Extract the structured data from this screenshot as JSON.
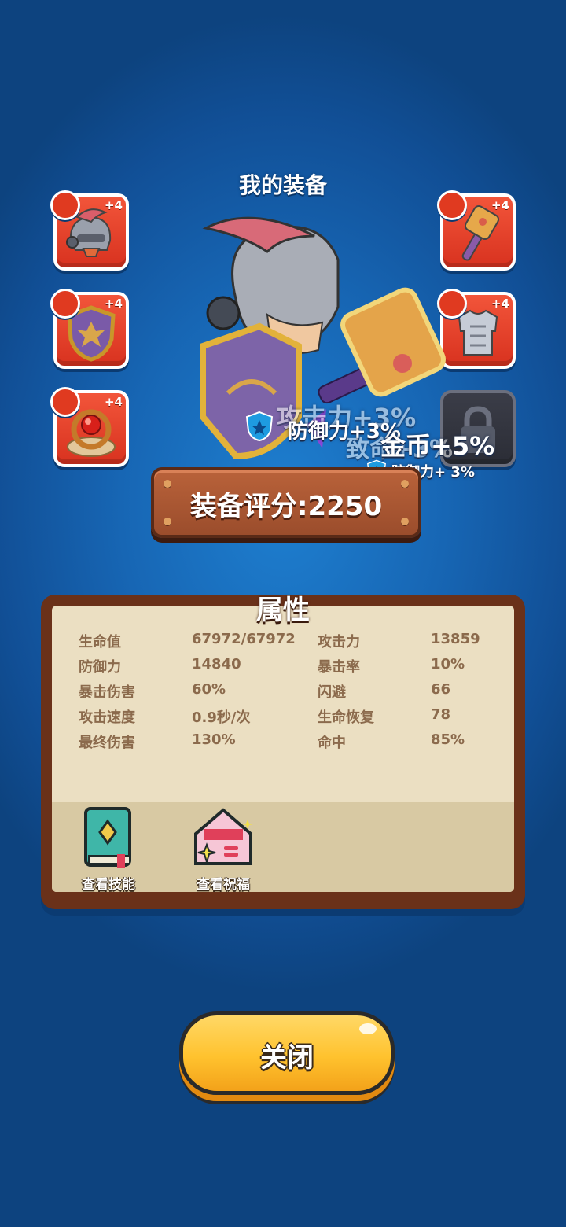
{
  "equipment": {
    "title": "我的装备",
    "slots": [
      {
        "icon": "helmet-icon",
        "level": "+4"
      },
      {
        "icon": "shield-icon",
        "level": "+4"
      },
      {
        "icon": "ring-icon",
        "level": "+4"
      },
      {
        "icon": "hammer-icon",
        "level": "+4"
      },
      {
        "icon": "armor-icon",
        "level": "+4"
      },
      {
        "icon": "lock-icon",
        "level": ""
      }
    ],
    "buffs": {
      "attack": "攻击力+3%",
      "defense_big": "防御力+3%",
      "crit": "致命+3%",
      "gold": "金币+5%",
      "defense_small": "防御力+ 3%"
    },
    "score_label": "装备评分:2250"
  },
  "attributes": {
    "title": "属性",
    "rows": [
      {
        "name1": "生命值",
        "value1": "67972/67972",
        "name2": "攻击力",
        "value2": "13859"
      },
      {
        "name1": "防御力",
        "value1": "14840",
        "name2": "暴击率",
        "value2": "10%"
      },
      {
        "name1": "暴击伤害",
        "value1": "60%",
        "name2": "闪避",
        "value2": "66"
      },
      {
        "name1": "攻击速度",
        "value1": "0.9秒/次",
        "name2": "生命恢复",
        "value2": "78"
      },
      {
        "name1": "最终伤害",
        "value1": "130%",
        "name2": "命中",
        "value2": "85%"
      }
    ],
    "view_skills_label": "查看技能",
    "view_blessings_label": "查看祝福"
  },
  "close_label": "关闭",
  "colors": {
    "background": "#1766b4",
    "slot_red": "#e2422a",
    "button_yellow": "#ffc22e",
    "panel_brown": "#6a3119",
    "panel_paper": "#ebdfc2"
  }
}
